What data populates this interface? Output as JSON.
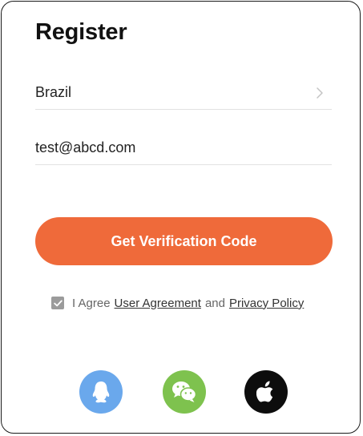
{
  "page": {
    "title": "Register"
  },
  "form": {
    "country_value": "Brazil",
    "email_value": "test@abcd.com"
  },
  "actions": {
    "get_code_label": "Get Verification Code"
  },
  "agreement": {
    "checked": true,
    "prefix": "I Agree",
    "user_agreement_link": "User Agreement",
    "conjunction": "and",
    "privacy_policy_link": "Privacy Policy"
  },
  "social_login": {
    "items": [
      {
        "icon": "qq-icon",
        "color": "#6aa8ec"
      },
      {
        "icon": "wechat-icon",
        "color": "#7ec24e"
      },
      {
        "icon": "apple-icon",
        "color": "#0d0d0d"
      }
    ]
  },
  "colors": {
    "accent": "#ef6a3a",
    "checkbox": "#9b9b9b"
  }
}
